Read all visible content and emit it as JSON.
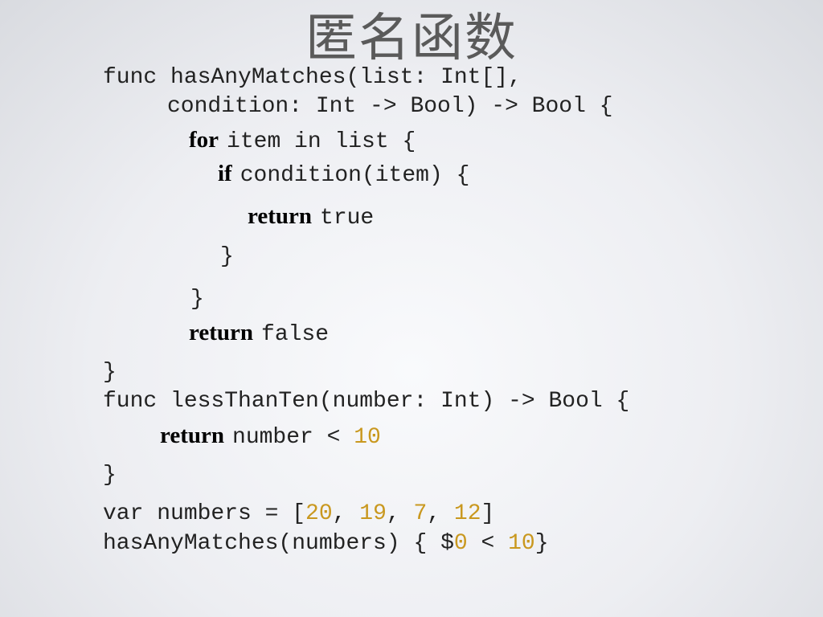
{
  "slide": {
    "title": "匿名函数",
    "code": {
      "l1": "func hasAnyMatches(list: Int[],",
      "l2": "condition: Int -> Bool) -> Bool {",
      "l3_kw": "for",
      "l3": "item in list {",
      "l4_kw": "if",
      "l4": "condition(item) {",
      "l5_kw": "return",
      "l5": "true",
      "l6": "}",
      "l7": "}",
      "l8_kw": "return",
      "l8": "false",
      "l9": "}",
      "l10": "func lessThanTen(number: Int) -> Bool {",
      "l11_kw": "return",
      "l11": "number < ",
      "l11_num": "10",
      "l12": "}",
      "l13_a": "var numbers = [",
      "l13_n1": "20",
      "l13_b": ", ",
      "l13_n2": "19",
      "l13_c": ", ",
      "l13_n3": "7",
      "l13_d": ", ",
      "l13_n4": "12",
      "l13_e": "]",
      "l14_a": "hasAnyMatches(numbers) { $",
      "l14_n1": "0",
      "l14_b": " < ",
      "l14_n2": "10",
      "l14_c": "}"
    },
    "colors": {
      "number_literal": "#c9981f",
      "title": "#5a5a5a",
      "code": "#222222"
    }
  }
}
